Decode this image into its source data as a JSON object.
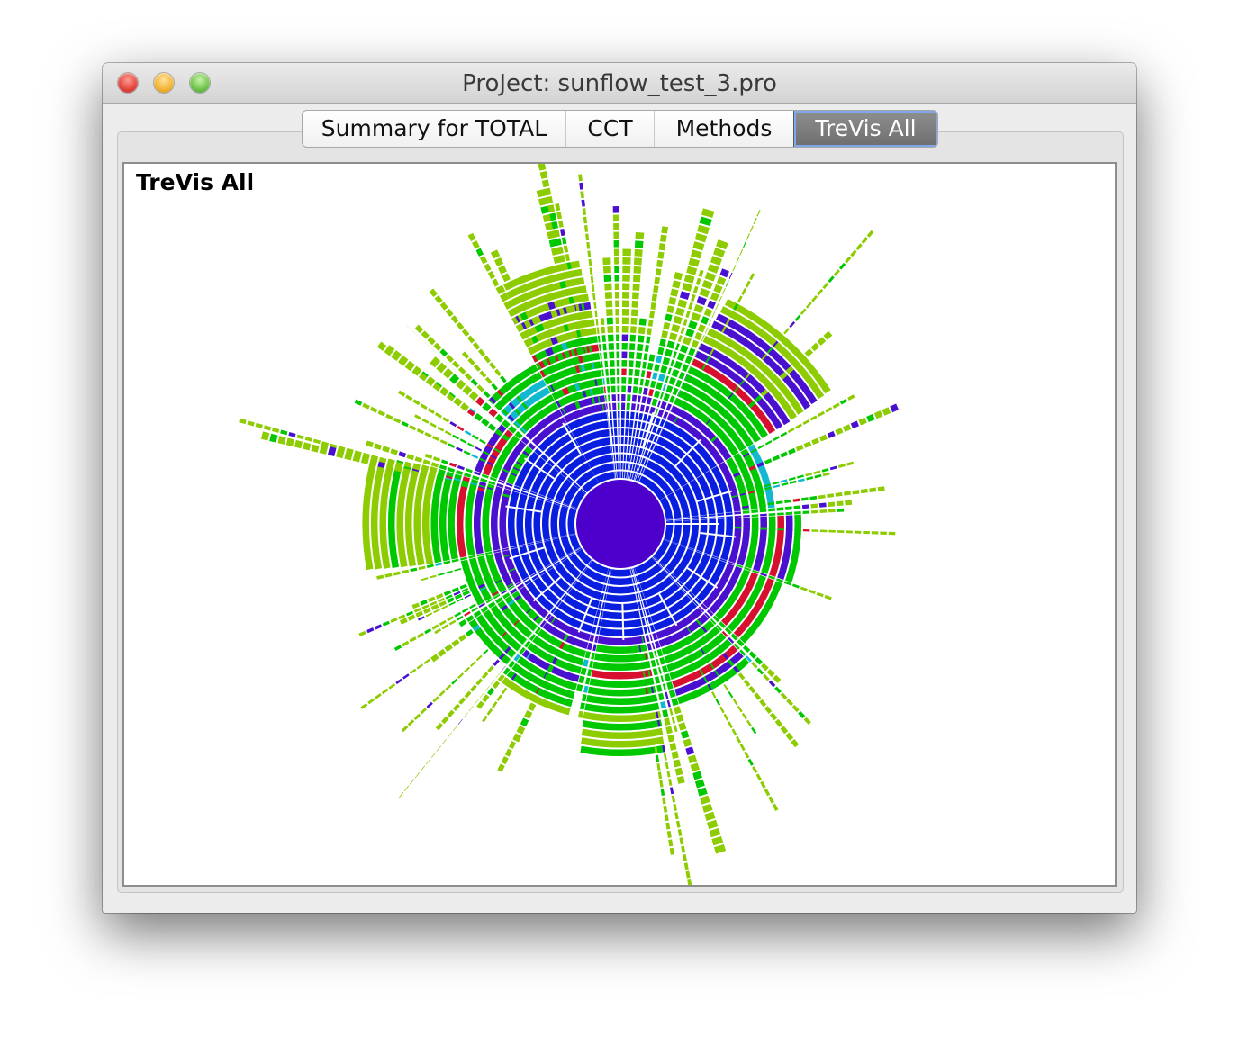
{
  "window": {
    "title": "ProJect: sunflow_test_3.pro"
  },
  "tabs": [
    {
      "label": "Summary for TOTAL",
      "active": false
    },
    {
      "label": "CCT",
      "active": false
    },
    {
      "label": "Methods",
      "active": false
    },
    {
      "label": "TreVis All",
      "active": true
    }
  ],
  "content": {
    "title": "TreVis All"
  },
  "visualization": {
    "type": "radial-tree-sunburst",
    "colors": {
      "root": "#4d00cc",
      "blue": "#0a1ee0",
      "indigo": "#4a10d0",
      "green": "#00c800",
      "lime": "#8ccc00",
      "red": "#d81030",
      "cyan": "#10b8d0",
      "separator": "#ffffff"
    }
  }
}
